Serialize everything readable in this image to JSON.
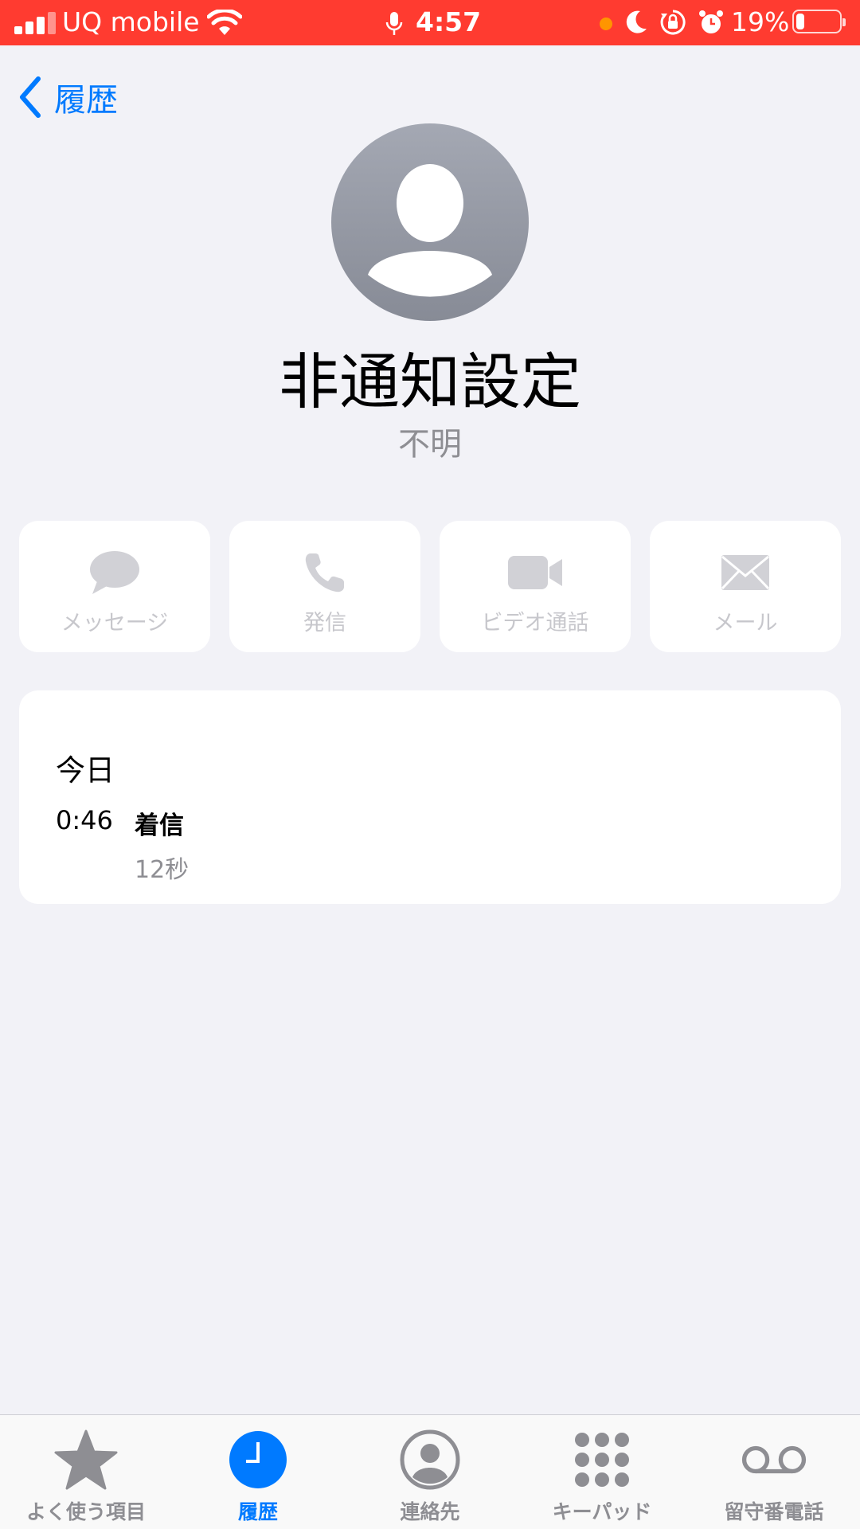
{
  "status_bar": {
    "carrier": "UQ mobile",
    "time": "4:57",
    "battery_percent": "19%",
    "battery_level": 0.19,
    "bg_color": "#ff3b30",
    "icons": [
      "signal-icon",
      "wifi-icon",
      "mic-icon",
      "recording-dot-icon",
      "moon-icon",
      "rotation-lock-icon",
      "alarm-icon",
      "battery-icon"
    ]
  },
  "nav": {
    "back_label": "履歴"
  },
  "contact": {
    "name": "非通知設定",
    "subtitle": "不明"
  },
  "actions": [
    {
      "label": "メッセージ",
      "icon": "message-icon"
    },
    {
      "label": "発信",
      "icon": "phone-icon"
    },
    {
      "label": "ビデオ通話",
      "icon": "video-icon"
    },
    {
      "label": "メール",
      "icon": "mail-icon"
    }
  ],
  "history": {
    "date": "今日",
    "entries": [
      {
        "time": "0:46",
        "type": "着信",
        "duration": "12秒"
      }
    ]
  },
  "tab_bar": {
    "active_index": 1,
    "accent_color": "#007aff",
    "tabs": [
      {
        "label": "よく使う項目",
        "icon": "star-icon"
      },
      {
        "label": "履歴",
        "icon": "clock-icon"
      },
      {
        "label": "連絡先",
        "icon": "contact-icon"
      },
      {
        "label": "キーパッド",
        "icon": "keypad-icon"
      },
      {
        "label": "留守番電話",
        "icon": "voicemail-icon"
      }
    ]
  }
}
